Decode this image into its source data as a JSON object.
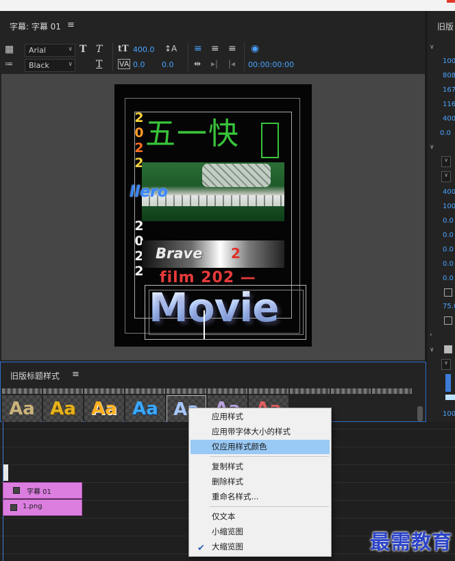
{
  "title_panel": {
    "title": "字幕: 字幕 01",
    "font_family": "Arial",
    "font_style": "Black",
    "font_size": "400.0",
    "tracking": "0.0",
    "leading": "0.0",
    "timecode": "00:00:00:00"
  },
  "canvas": {
    "numbers_top": [
      "2",
      "0",
      "2",
      "2"
    ],
    "numbers_bottom": [
      "2",
      "0",
      "2",
      "2"
    ],
    "headline_cn": "五一快",
    "hero_text": "llero",
    "brave_text": "Brave",
    "brave_num": "2",
    "film_text": "film 202 —",
    "movie_text": "Movie"
  },
  "right_panel": {
    "title": "旧版",
    "values": [
      "100",
      "808",
      "167",
      "116",
      "400",
      "0.0",
      "400",
      "100",
      "0.0",
      "0.0",
      "0.0",
      "0.0",
      "0.0",
      "75.0",
      "100"
    ]
  },
  "styles_panel": {
    "title": "旧版标题样式",
    "swatch_label": "Aa"
  },
  "timeline": {
    "clip1": "字幕 01",
    "clip2": "1.png"
  },
  "context_menu": {
    "items": [
      "应用样式",
      "应用带字体大小的样式",
      "仅应用样式颜色",
      "复制样式",
      "删除样式",
      "重命名样式...",
      "仅文本",
      "小缩览图",
      "大缩览图"
    ],
    "highlighted": "仅应用样式颜色",
    "checked": "大缩览图"
  },
  "watermark": "最需教育",
  "colors": {
    "accent": "#4aa3ff",
    "highlight": "#99c9f5",
    "clip": "#dc7ee0",
    "headline_green": "#39c43b"
  }
}
